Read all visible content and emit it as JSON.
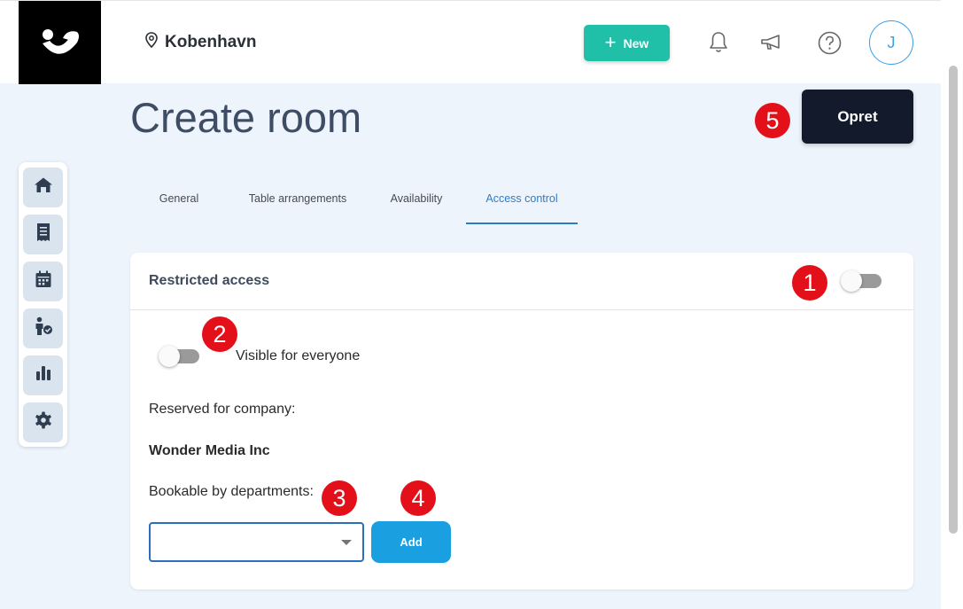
{
  "header": {
    "location": "Kobenhavn",
    "new_button": "New",
    "avatar_initial": "J",
    "accent_color": "#1fbfa8"
  },
  "page": {
    "title": "Create room",
    "submit_button": "Opret"
  },
  "sidebar": {
    "items": [
      {
        "icon": "home-icon"
      },
      {
        "icon": "receipt-icon"
      },
      {
        "icon": "calendar-icon"
      },
      {
        "icon": "person-check-icon"
      },
      {
        "icon": "bar-chart-icon"
      },
      {
        "icon": "gear-icon"
      }
    ]
  },
  "tabs": [
    {
      "label": "General"
    },
    {
      "label": "Table arrangements"
    },
    {
      "label": "Availability"
    },
    {
      "label": "Access control",
      "active": true
    }
  ],
  "access_card": {
    "title": "Restricted access",
    "restricted_toggle": false,
    "visible_toggle": false,
    "visible_label": "Visible for everyone",
    "reserved_label": "Reserved for company:",
    "company_name": "Wonder Media Inc",
    "departments_label": "Bookable by departments:",
    "departments_value": "",
    "add_button": "Add"
  },
  "markers": [
    "1",
    "2",
    "3",
    "4",
    "5"
  ]
}
